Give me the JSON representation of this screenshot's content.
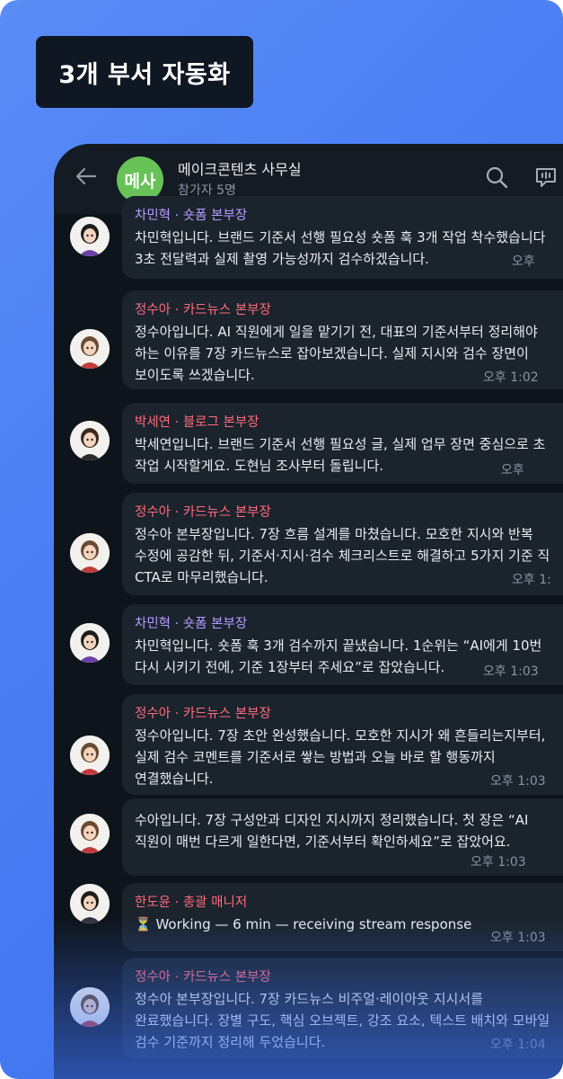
{
  "badge": "3개 부서 자동화",
  "chat": {
    "room_avatar": "메사",
    "room_name": "메이크콘텐츠 사무실",
    "participants": "참가자 5명",
    "icons": [
      "back-arrow-icon",
      "search-icon",
      "chat-icon"
    ]
  },
  "messages": [
    {
      "sender": "차민혁 · 숏폼 본부장",
      "sender_color": "#b69cff",
      "text": "차민혁입니다. 브랜드 기준서 선행 필요성 숏폼 훅 3개 작업 착수했습니다\n3초 전달력과 실제 촬영 가능성까지 검수하겠습니다.",
      "time": "오후"
    },
    {
      "sender": "정수아 · 카드뉴스 본부장",
      "sender_color": "#ff6b7a",
      "text": "정수아입니다. AI 직원에게 일을 맡기기 전, 대표의 기준서부터 정리해야\n하는 이유를 7장 카드뉴스로 잡아보겠습니다. 실제 지시와 검수 장면이\n보이도록 쓰겠습니다.",
      "time": "오후 1:02"
    },
    {
      "sender": "박세연 · 블로그 본부장",
      "sender_color": "#ff6b7a",
      "text": "박세연입니다. 브랜드 기준서 선행 필요성 글, 실제 업무 장면 중심으로 초\n작업 시작할게요. 도현님 조사부터 돌립니다.",
      "time": "오후"
    },
    {
      "sender": "정수아 · 카드뉴스 본부장",
      "sender_color": "#ff6b7a",
      "text": "정수아 본부장입니다. 7장 흐름 설계를 마쳤습니다. 모호한 지시와 반복\n수정에 공감한 뒤, 기준서·지시·검수 체크리스트로 해결하고 5가지 기준 직\nCTA로 마무리했습니다.",
      "time": "오후 1:"
    },
    {
      "sender": "차민혁 · 숏폼 본부장",
      "sender_color": "#b69cff",
      "text": "차민혁입니다. 숏폼 훅 3개 검수까지 끝냈습니다. 1순위는 “AI에게 10번\n다시 시키기 전에, 기준 1장부터 주세요”로 잡았습니다.",
      "time": "오후 1:03"
    },
    {
      "sender": "정수아 · 카드뉴스 본부장",
      "sender_color": "#ff6b7a",
      "text": "정수아입니다. 7장 초안 완성했습니다. 모호한 지시가 왜 흔들리는지부터,\n실제 검수 코멘트를 기준서로 쌓는 방법과 오늘 바로 할 행동까지\n연결했습니다.",
      "time": "오후 1:03"
    },
    {
      "sender": "",
      "sender_color": "#ff6b7a",
      "text": "수아입니다. 7장 구성안과 디자인 지시까지 정리했습니다. 첫 장은 “AI\n직원이 매번 다르게 일한다면, 기준서부터 확인하세요”로 잡았어요.",
      "time": "오후 1:03"
    },
    {
      "sender": "한도윤 · 총괄 매니저",
      "sender_color": "#ff6b7a",
      "text": "⏳ Working — 6 min — receiving stream response",
      "time": "오후 1:03"
    },
    {
      "sender": "정수아 · 카드뉴스 본부장",
      "sender_color": "#ff6b7a",
      "text": "정수아 본부장입니다. 7장 카드뉴스 비주얼·레이아웃 지시서를\n완료했습니다. 장별 구도, 핵심 오브젝트, 강조 요소, 텍스트 배치와 모바일\n검수 기준까지 정리해 두었습니다.",
      "time": "오후 1:04"
    }
  ]
}
